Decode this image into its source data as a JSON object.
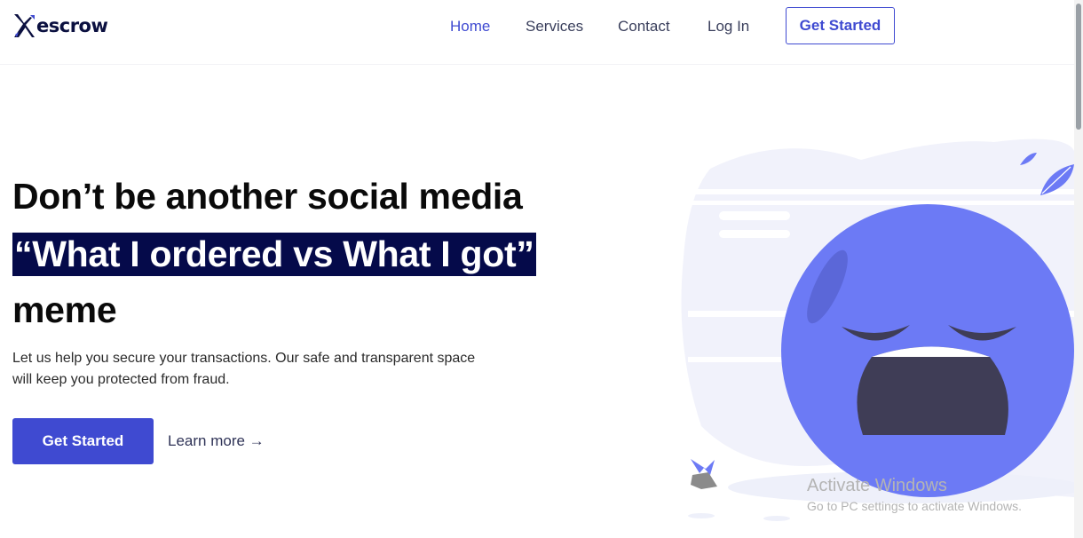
{
  "brand": {
    "name": "escrow"
  },
  "nav": {
    "items": [
      {
        "label": "Home",
        "active": true
      },
      {
        "label": "Services",
        "active": false
      },
      {
        "label": "Contact",
        "active": false
      },
      {
        "label": "Log In",
        "active": false
      }
    ],
    "cta_label": "Get Started"
  },
  "hero": {
    "line1": "Don’t be another social media",
    "highlight": "“What I ordered vs What I got”",
    "line3": "meme",
    "subtitle": "Let us help you secure your transactions. Our safe and transparent space will keep you protected from fraud.",
    "primary_button": "Get Started",
    "secondary_link": "Learn more →"
  },
  "illustration": {
    "icon": "crying-face-icon"
  },
  "watermark": {
    "title": "Activate Windows",
    "subtitle": "Go to PC settings to activate Windows."
  },
  "colors": {
    "accent": "#3f4ad1",
    "highlight_bg": "#050a4a",
    "brand_dark": "#0b1040",
    "face": "#6c7af5"
  }
}
